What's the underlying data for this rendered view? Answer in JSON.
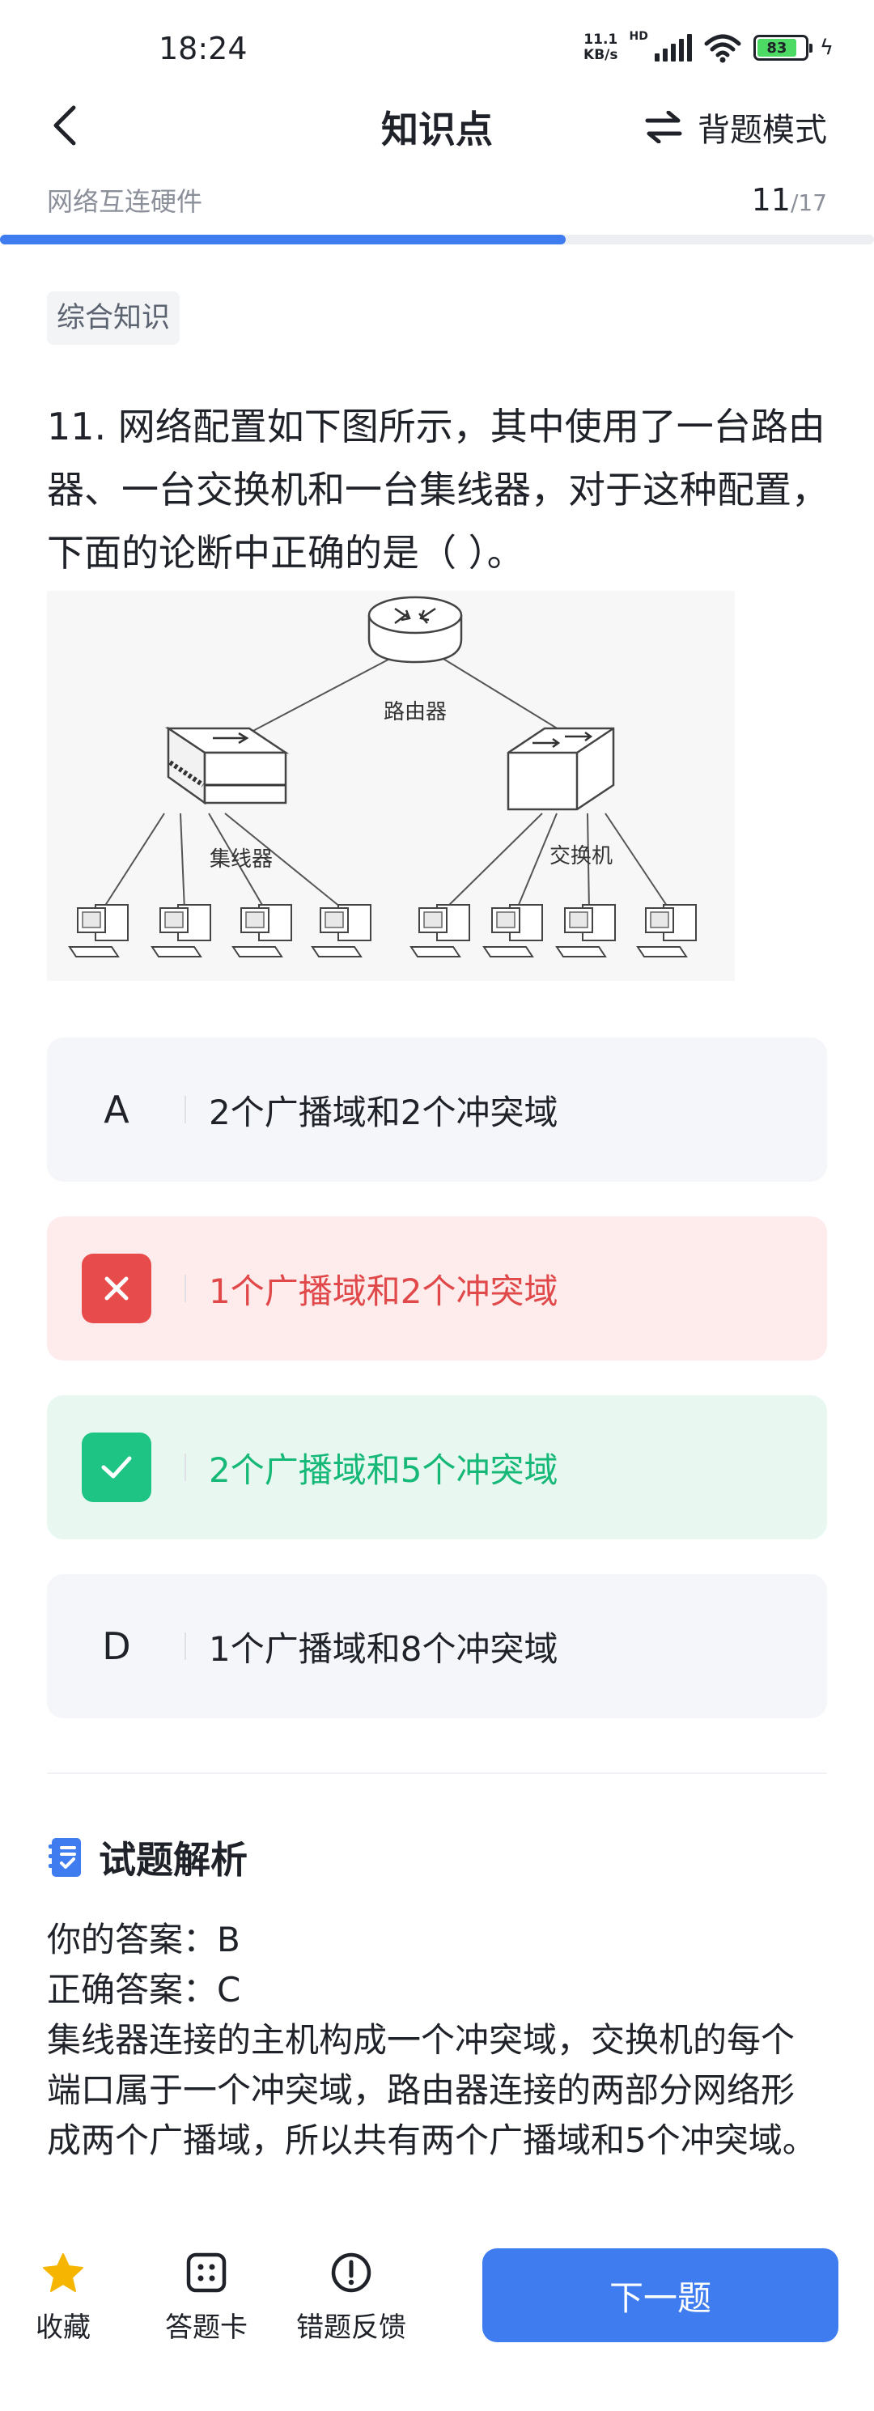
{
  "status_bar": {
    "time": "18:24",
    "net_speed_value": "11.1",
    "net_speed_unit": "KB/s",
    "hd_label": "HD",
    "battery_level": "83"
  },
  "header": {
    "title": "知识点",
    "mode_label": "背题模式"
  },
  "progress": {
    "chapter": "网络互连硬件",
    "current": "11",
    "total": "/17",
    "fraction": 0.647
  },
  "question": {
    "category": "综合知识",
    "text": "11. 网络配置如下图所示，其中使用了一台路由器、一台交换机和一台集线器，对于这种配置，下面的论断中正确的是（ ）。",
    "diagram": {
      "router_label": "路由器",
      "hub_label": "集线器",
      "switch_label": "交换机"
    }
  },
  "options": [
    {
      "letter": "A",
      "text": "2个广播域和2个冲突域",
      "state": "default"
    },
    {
      "letter": "B",
      "text": "1个广播域和2个冲突域",
      "state": "wrong"
    },
    {
      "letter": "C",
      "text": "2个广播域和5个冲突域",
      "state": "correct"
    },
    {
      "letter": "D",
      "text": "1个广播域和8个冲突域",
      "state": "default"
    }
  ],
  "analysis": {
    "title": "试题解析",
    "your_answer": "你的答案：B",
    "correct_answer": "正确答案：C",
    "explanation": "集线器连接的主机构成一个冲突域，交换机的每个端口属于一个冲突域，路由器连接的两部分网络形成两个广播域，所以共有两个广播域和5个冲突域。"
  },
  "bottom_bar": {
    "favorite_label": "收藏",
    "answer_card_label": "答题卡",
    "feedback_label": "错题反馈",
    "next_label": "下一题"
  },
  "colors": {
    "accent": "#3e7cf0",
    "wrong": "#e84b4b",
    "correct": "#1ec483",
    "star": "#f6b500"
  }
}
